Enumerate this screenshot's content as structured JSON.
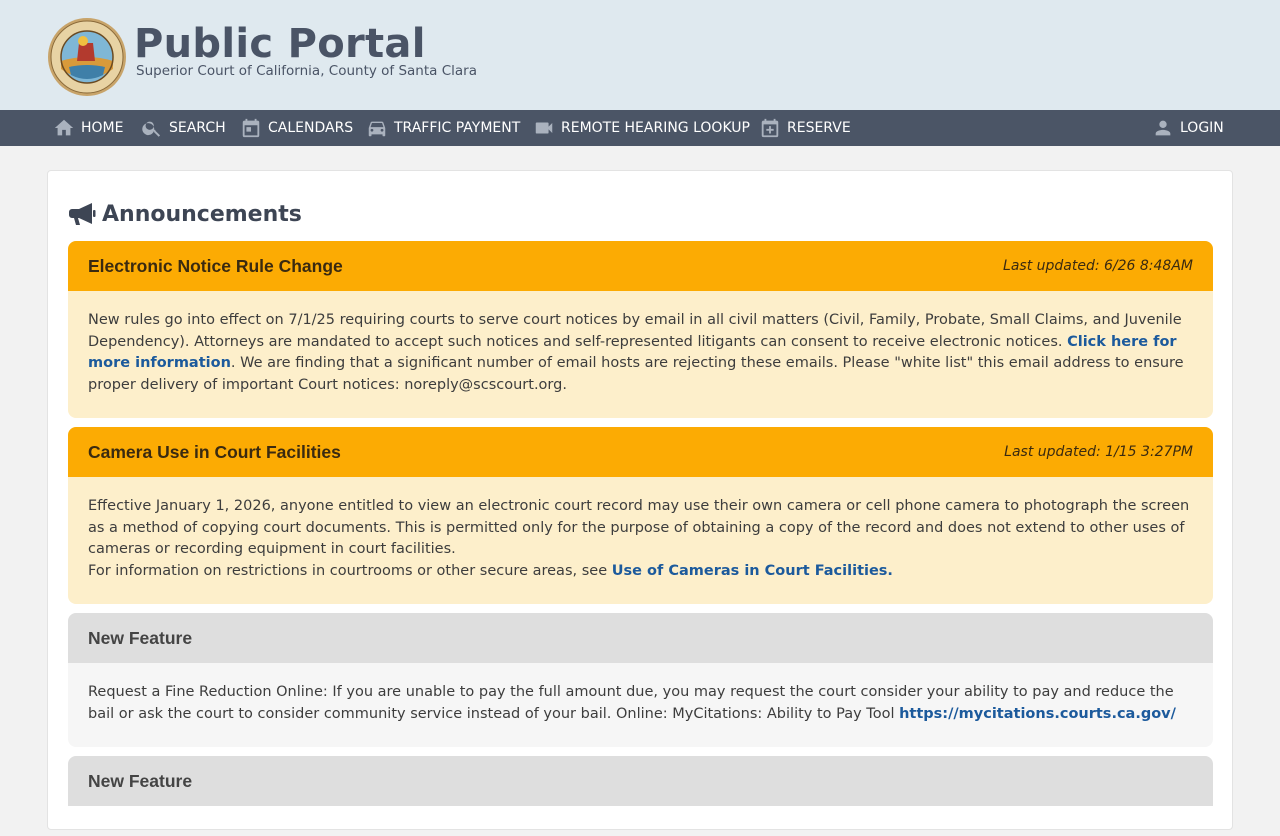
{
  "header": {
    "title": "Public Portal",
    "subtitle": "Superior Court of California, County of Santa Clara"
  },
  "nav": {
    "items": [
      {
        "label": "HOME",
        "icon": "home-icon"
      },
      {
        "label": "SEARCH",
        "icon": "search-icon"
      },
      {
        "label": "CALENDARS",
        "icon": "calendar-icon"
      },
      {
        "label": "TRAFFIC PAYMENT",
        "icon": "car-icon"
      },
      {
        "label": "REMOTE HEARING LOOKUP",
        "icon": "video-camera-icon"
      },
      {
        "label": "RESERVE",
        "icon": "calendar-plus-icon"
      }
    ],
    "login": {
      "label": "LOGIN",
      "icon": "user-icon"
    }
  },
  "announcements": {
    "heading": "Announcements",
    "icon": "megaphone-icon",
    "items": [
      {
        "title": "Electronic Notice Rule Change",
        "updated": "Last updated: 6/26 8:48AM",
        "text1": "New rules go into effect on 7/1/25 requiring courts to serve court notices by email in all civil matters (Civil, Family, Probate, Small Claims, and Juvenile Dependency). Attorneys are mandated to accept such notices and self-represented litigants can consent to receive electronic notices. ",
        "link": "Click here for more information",
        "text2": ". We are finding that a significant number of email hosts are rejecting these emails. Please \"white list\" this email address to ensure proper delivery of important Court notices: noreply@scscourt.org."
      },
      {
        "title": "Camera Use in Court Facilities",
        "updated": "Last updated: 1/15 3:27PM",
        "text1": "Effective January 1, 2026, anyone entitled to view an electronic court record may use their own camera or cell phone camera to photograph the screen as a method of copying court documents. This is permitted only for the purpose of obtaining a copy of the record and does not extend to other uses of cameras or recording equipment in court facilities.",
        "text2": "For information on restrictions in courtrooms or other secure areas, see ",
        "link": "Use of Cameras in Court Facilities."
      },
      {
        "title": "New Feature",
        "text1": "Request a Fine Reduction Online: If you are unable to pay the full amount due, you may request the court consider your ability to pay and reduce the bail or ask the court to consider community service instead of your bail. Online: MyCitations: Ability to Pay Tool ",
        "link": "https://mycitations.courts.ca.gov/"
      },
      {
        "title": "New Feature"
      }
    ]
  },
  "colors": {
    "header_bg": "#dfe9ef",
    "nav_bg": "#4b5566",
    "warning_head": "#fcab03",
    "warning_body": "#fdefcb",
    "info_head": "#dedede",
    "link": "#1c5a9c"
  }
}
